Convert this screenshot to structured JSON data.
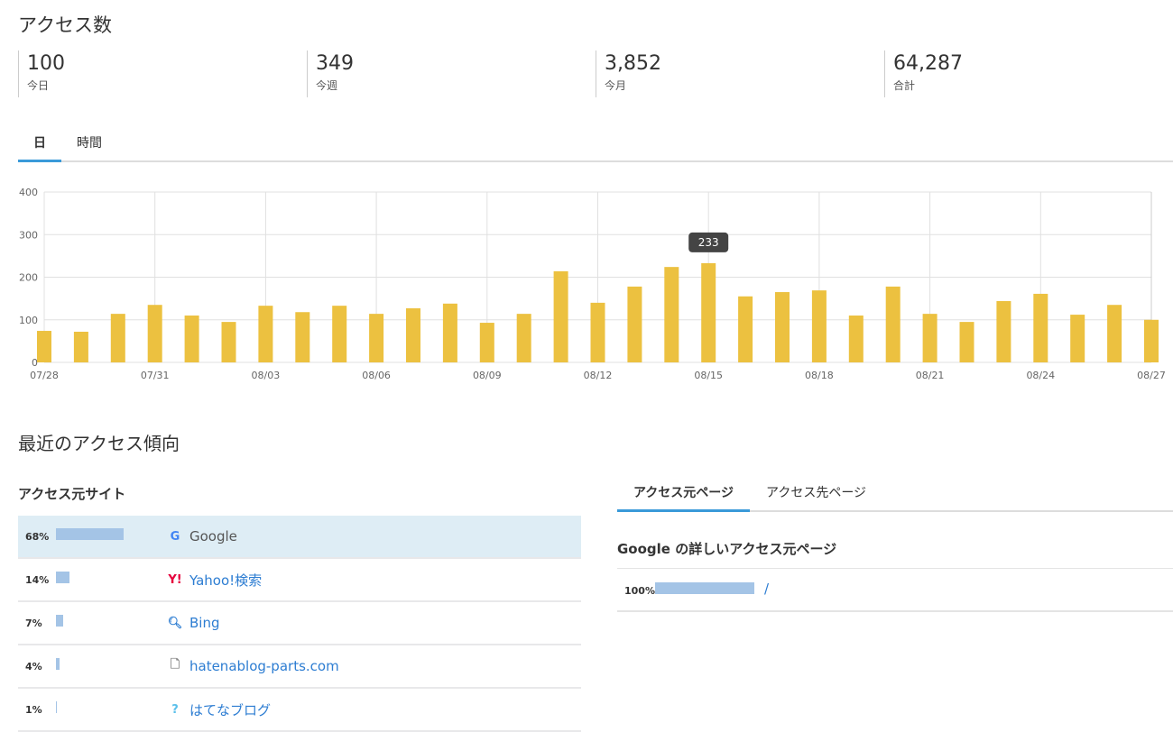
{
  "title": "アクセス数",
  "stats": [
    {
      "value": "100",
      "label": "今日"
    },
    {
      "value": "349",
      "label": "今週"
    },
    {
      "value": "3,852",
      "label": "今月"
    },
    {
      "value": "64,287",
      "label": "合計"
    }
  ],
  "tabs": [
    "日",
    "時間"
  ],
  "chart_data": {
    "type": "bar",
    "color": "#ecc140",
    "ylim": [
      0,
      400
    ],
    "yticks": [
      0,
      100,
      200,
      300,
      400
    ],
    "categories": [
      "07/28",
      "07/29",
      "07/30",
      "07/31",
      "08/01",
      "08/02",
      "08/03",
      "08/04",
      "08/05",
      "08/06",
      "08/07",
      "08/08",
      "08/09",
      "08/10",
      "08/11",
      "08/12",
      "08/13",
      "08/14",
      "08/15",
      "08/16",
      "08/17",
      "08/18",
      "08/19",
      "08/20",
      "08/21",
      "08/22",
      "08/23",
      "08/24",
      "08/25",
      "08/26",
      "08/27"
    ],
    "values": [
      74,
      72,
      114,
      135,
      110,
      95,
      133,
      118,
      133,
      114,
      127,
      138,
      93,
      114,
      214,
      140,
      178,
      224,
      233,
      155,
      165,
      169,
      110,
      178,
      114,
      95,
      144,
      161,
      112,
      135,
      100
    ],
    "xticklabels": [
      "07/28",
      "07/31",
      "08/03",
      "08/06",
      "08/09",
      "08/12",
      "08/15",
      "08/18",
      "08/21",
      "08/24",
      "08/27"
    ],
    "tooltip": {
      "category": "08/15",
      "text": "233"
    }
  },
  "trend_title": "最近のアクセス傾向",
  "sources_title": "アクセス元サイト",
  "sources": [
    {
      "pct": "68%",
      "value": 68,
      "name": "Google",
      "icon": "google-icon"
    },
    {
      "pct": "14%",
      "value": 14,
      "name": "Yahoo!検索",
      "icon": "yahoo-icon"
    },
    {
      "pct": "7%",
      "value": 7,
      "name": "Bing",
      "icon": "search-icon"
    },
    {
      "pct": "4%",
      "value": 4,
      "name": "hatenablog-parts.com",
      "icon": "document-icon"
    },
    {
      "pct": "1%",
      "value": 1,
      "name": "はてなブログ",
      "icon": "hatena-icon"
    }
  ],
  "right_tabs": [
    "アクセス元ページ",
    "アクセス先ページ"
  ],
  "detail_title": "Google の詳しいアクセス元ページ",
  "detail_rows": [
    {
      "pct": "100%",
      "value": 100,
      "name": "/"
    }
  ]
}
